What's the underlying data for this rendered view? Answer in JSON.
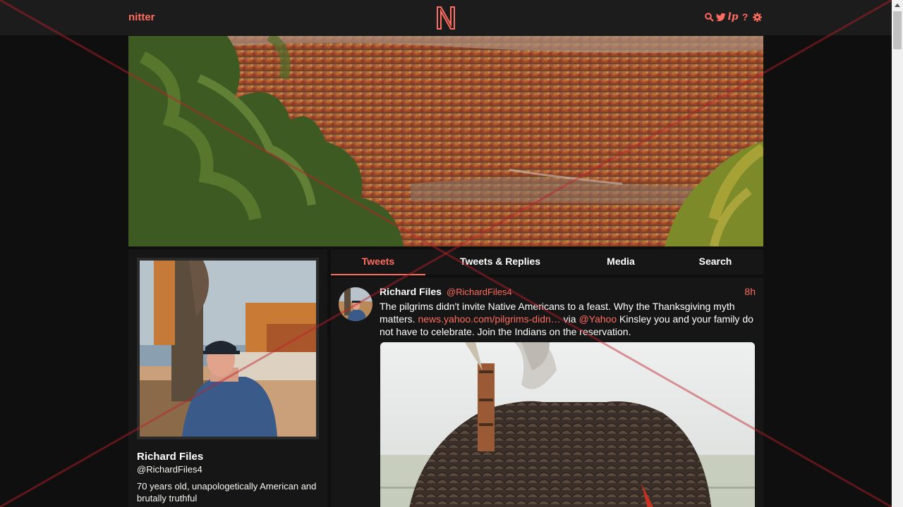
{
  "nav": {
    "brand": "nitter",
    "icons": [
      "search-icon",
      "twitter-icon",
      "rss-icon",
      "help-icon",
      "settings-icon"
    ],
    "accent": "#ff6c60"
  },
  "profile": {
    "fullname": "Richard Files",
    "username": "@RichardFiles4",
    "bio": "70 years old, unapologetically American and brutally truthful"
  },
  "tabs": [
    {
      "label": "Tweets",
      "active": true
    },
    {
      "label": "Tweets & Replies",
      "active": false
    },
    {
      "label": "Media",
      "active": false
    },
    {
      "label": "Search",
      "active": false
    }
  ],
  "tweet": {
    "fullname": "Richard Files",
    "username": "@RichardFiles4",
    "date": "8h",
    "text_before": "The pilgrims didn't invite Native Americans to a feast. Why the Thanksgiving myth matters. ",
    "link": "news.yahoo.com/pilgrims-didn…",
    "text_mid": " via ",
    "mention": "@Yahoo",
    "text_after": " Kinsley you and your family do not have to celebrate. Join the Indians on the reservation."
  },
  "colors": {
    "background": "#0f0f0f",
    "panel": "#161616",
    "accent": "#ff6c60"
  }
}
